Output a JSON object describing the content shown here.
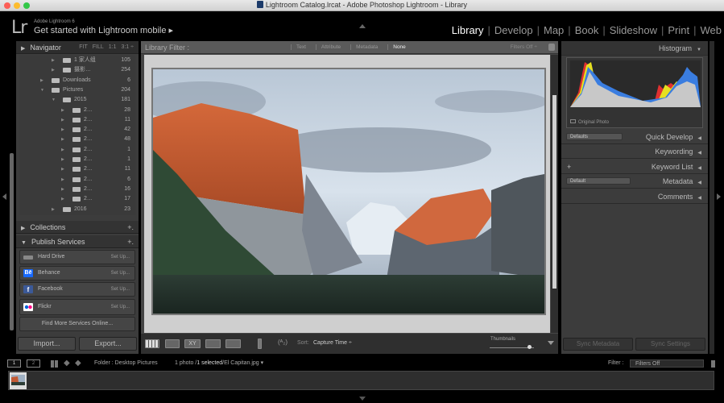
{
  "window": {
    "title": "Lightroom Catalog.lrcat - Adobe Photoshop Lightroom - Library",
    "traffic_lights": {
      "close": "#fc5f57",
      "minimize": "#fdbc2e",
      "zoom": "#33c748"
    }
  },
  "identity_plate": {
    "logo": "Lr",
    "app_name": "Adobe Lightroom 6",
    "message": "Get started with Lightroom mobile ▸"
  },
  "modules": [
    {
      "label": "Library",
      "active": true
    },
    {
      "label": "Develop",
      "active": false
    },
    {
      "label": "Map",
      "active": false
    },
    {
      "label": "Book",
      "active": false
    },
    {
      "label": "Slideshow",
      "active": false
    },
    {
      "label": "Print",
      "active": false
    },
    {
      "label": "Web",
      "active": false
    }
  ],
  "left_panel": {
    "navigator": {
      "label": "Navigator",
      "zoom_options": [
        "FIT",
        "FILL",
        "1:1",
        "3:1 ÷"
      ]
    },
    "folders": [
      {
        "name": "1 家人组",
        "count": "105",
        "level": 2,
        "expanded": false
      },
      {
        "name": "摄影…",
        "count": "254",
        "level": 2,
        "expanded": false
      },
      {
        "name": "Downloads",
        "count": "6",
        "level": 1,
        "expanded": false
      },
      {
        "name": "Pictures",
        "count": "204",
        "level": 1,
        "expanded": true
      },
      {
        "name": "2015",
        "count": "181",
        "level": 2,
        "expanded": true
      },
      {
        "name": "2…",
        "count": "28",
        "level": 3,
        "expanded": false
      },
      {
        "name": "2…",
        "count": "11",
        "level": 3,
        "expanded": false
      },
      {
        "name": "2…",
        "count": "42",
        "level": 3,
        "expanded": false
      },
      {
        "name": "2…",
        "count": "48",
        "level": 3,
        "expanded": false
      },
      {
        "name": "2…",
        "count": "1",
        "level": 3,
        "expanded": false
      },
      {
        "name": "2…",
        "count": "1",
        "level": 3,
        "expanded": false
      },
      {
        "name": "2…",
        "count": "11",
        "level": 3,
        "expanded": false
      },
      {
        "name": "2…",
        "count": "6",
        "level": 3,
        "expanded": false
      },
      {
        "name": "2…",
        "count": "16",
        "level": 3,
        "expanded": false
      },
      {
        "name": "2…",
        "count": "17",
        "level": 3,
        "expanded": false
      },
      {
        "name": "2016",
        "count": "23",
        "level": 2,
        "expanded": false
      }
    ],
    "collections": {
      "label": "Collections",
      "add": "+."
    },
    "publish_services": {
      "label": "Publish Services",
      "add": "+.",
      "items": [
        {
          "name": "Hard Drive",
          "action": "Set Up...",
          "icon": "hard-drive-icon",
          "color": "#888888"
        },
        {
          "name": "Behance",
          "action": "Set Up...",
          "icon": "behance-icon",
          "color": "#1769ff"
        },
        {
          "name": "Facebook",
          "action": "Set Up...",
          "icon": "facebook-icon",
          "color": "#3b5998"
        },
        {
          "name": "Flickr",
          "action": "Set Up...",
          "icon": "flickr-icon",
          "color": "#ffffff"
        }
      ],
      "find_more": "Find More Services Online..."
    },
    "import_label": "Import...",
    "export_label": "Export..."
  },
  "library_filter": {
    "label": "Library Filter :",
    "options": [
      "Text",
      "Attribute",
      "Metadata",
      "None"
    ],
    "active": "None",
    "preset": "Filters Off ÷"
  },
  "toolbar": {
    "sort_label": "Sort:",
    "sort_value": "Capture Time ÷",
    "thumbnails_label": "Thumbnails",
    "thumbnail_size": 0.85
  },
  "right_panel": {
    "histogram": {
      "label": "Histogram",
      "original_photo": "Original Photo"
    },
    "sections": [
      {
        "label": "Quick Develop",
        "select": "Defaults"
      },
      {
        "label": "Keywording"
      },
      {
        "label": "Keyword List",
        "plus": "+"
      },
      {
        "label": "Metadata",
        "select": "Default"
      },
      {
        "label": "Comments"
      }
    ],
    "sync_metadata": "Sync Metadata",
    "sync_settings": "Sync Settings"
  },
  "filmstrip": {
    "pages": [
      "1",
      "2"
    ],
    "source": "Folder : Desktop Pictures",
    "count_prefix": "1 photo /",
    "count_selected": "1 selected",
    "filename": "/El Capitan.jpg ▾",
    "filter_label": "Filter :",
    "filter_value": "Filters Off"
  }
}
